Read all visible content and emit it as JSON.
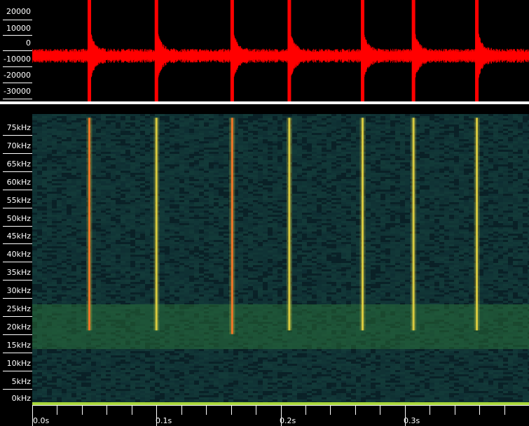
{
  "waveform": {
    "y_axis_labels": [
      "20000",
      "10000",
      "0",
      "-10000",
      "-20000",
      "-30000"
    ],
    "color": "#ff0000",
    "background": "#000000",
    "ylim": [
      -35000,
      25000
    ],
    "baseline": -8000,
    "noise_amplitude": 3500,
    "click_times_s": [
      0.046,
      0.1,
      0.161,
      0.207,
      0.266,
      0.307,
      0.358
    ],
    "click_peak_positive": 25000,
    "click_peak_negative": -35000
  },
  "spectrogram": {
    "y_axis_labels": [
      "75kHz",
      "70kHz",
      "65kHz",
      "60kHz",
      "55kHz",
      "50kHz",
      "45kHz",
      "40kHz",
      "35kHz",
      "30kHz",
      "25kHz",
      "20kHz",
      "15kHz",
      "10kHz",
      "5kHz",
      "0kHz"
    ],
    "freq_range_khz": [
      0,
      78
    ],
    "background_color": "#0d2a30",
    "noise_color": "#1f5a4a",
    "band_color": "#2e7a3a",
    "band_range_khz": [
      15,
      27
    ],
    "dc_line_color": "#a8d63a",
    "click_color": "#e0d040",
    "click_hot_color": "#ff5a20",
    "clicks": [
      {
        "time_s": 0.046,
        "fmin_khz": 20,
        "fmax_khz": 77,
        "strong": true
      },
      {
        "time_s": 0.1,
        "fmin_khz": 20,
        "fmax_khz": 77,
        "strong": false
      },
      {
        "time_s": 0.161,
        "fmin_khz": 19,
        "fmax_khz": 77,
        "strong": true
      },
      {
        "time_s": 0.207,
        "fmin_khz": 20,
        "fmax_khz": 77,
        "strong": false
      },
      {
        "time_s": 0.266,
        "fmin_khz": 20,
        "fmax_khz": 77,
        "strong": false
      },
      {
        "time_s": 0.307,
        "fmin_khz": 20,
        "fmax_khz": 77,
        "strong": false
      },
      {
        "time_s": 0.358,
        "fmin_khz": 20,
        "fmax_khz": 77,
        "strong": false
      }
    ]
  },
  "time_axis": {
    "labels": [
      "0.0s",
      "0.1s",
      "0.2s",
      "0.3s"
    ],
    "range_s": [
      0,
      0.4
    ],
    "minor_step_s": 0.02
  }
}
